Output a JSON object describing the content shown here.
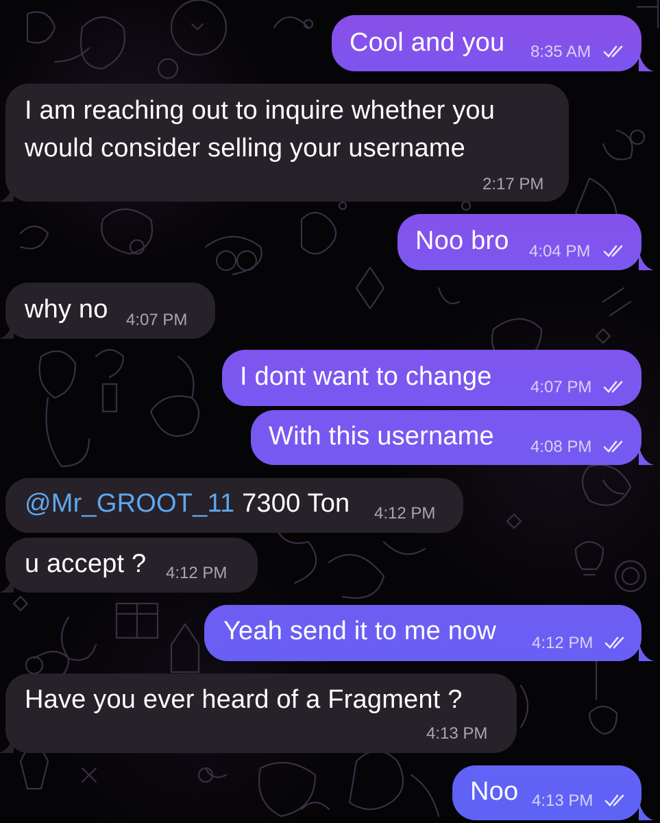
{
  "colors": {
    "background": "#050407",
    "incoming_bubble": "#272129",
    "outgoing_bubble_top": "#8a4fe6",
    "outgoing_bubble_bottom": "#5d63f6",
    "mention": "#5ea9ef",
    "incoming_time": "#aaa6ad",
    "outgoing_time": "#d9d2f6"
  },
  "messages": [
    {
      "direction": "outgoing",
      "text": "Cool and you",
      "time": "8:35 AM",
      "status": "read-double-check-icon"
    },
    {
      "direction": "incoming",
      "text_line1": "I am reaching out to inquire whether you",
      "text_line2": "would consider selling your username",
      "time": "2:17 PM"
    },
    {
      "direction": "outgoing",
      "text": "Noo bro",
      "time": "4:04 PM",
      "status": "read-double-check-icon"
    },
    {
      "direction": "incoming",
      "text": "why no",
      "time": "4:07 PM"
    },
    {
      "direction": "outgoing",
      "text": "I dont want to change",
      "time": "4:07 PM",
      "status": "read-double-check-icon"
    },
    {
      "direction": "outgoing",
      "text": "With this username",
      "time": "4:08 PM",
      "status": "read-double-check-icon"
    },
    {
      "direction": "incoming",
      "mention": "@Mr_GROOT_11",
      "text": "7300 Ton",
      "time": "4:12 PM"
    },
    {
      "direction": "incoming",
      "text": "u accept ?",
      "time": "4:12 PM"
    },
    {
      "direction": "outgoing",
      "text": "Yeah send it to me now",
      "time": "4:12 PM",
      "status": "read-double-check-icon"
    },
    {
      "direction": "incoming",
      "text": "Have you ever heard of a Fragment ?",
      "time": "4:13 PM"
    },
    {
      "direction": "outgoing",
      "text": "Noo",
      "time": "4:13 PM",
      "status": "read-double-check-icon"
    }
  ]
}
